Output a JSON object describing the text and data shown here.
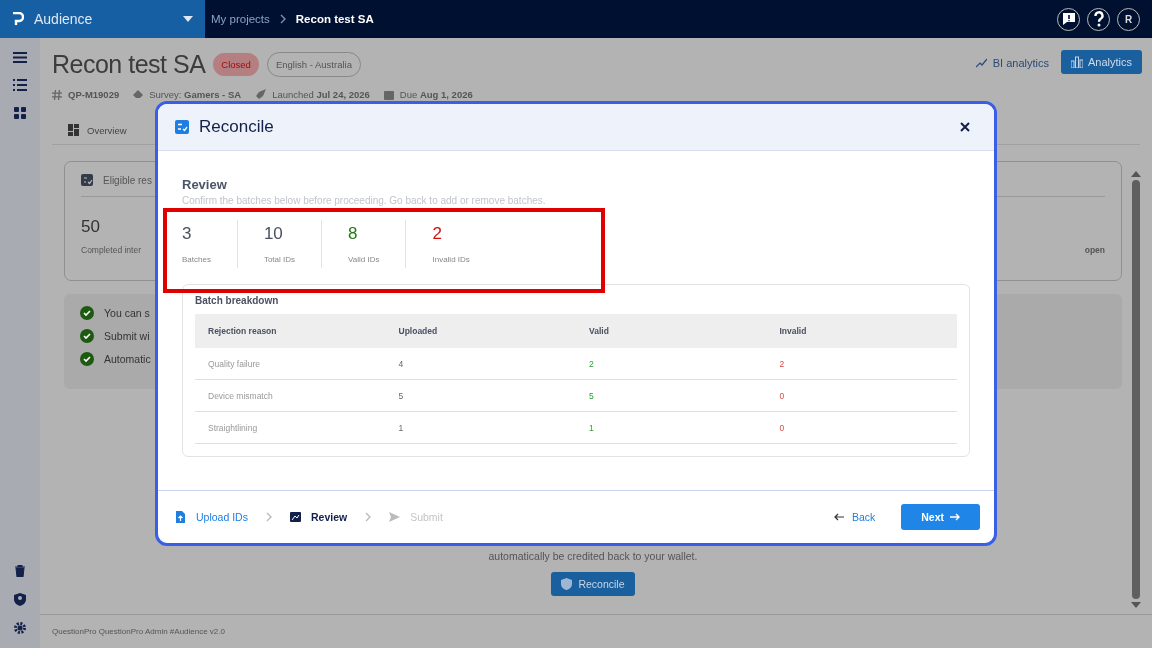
{
  "topbar": {
    "product": "Audience",
    "breadcrumb": [
      {
        "label": "My projects",
        "current": false
      },
      {
        "label": "Recon test SA",
        "current": true
      }
    ],
    "avatar": "R"
  },
  "project": {
    "title": "Recon test SA",
    "status": "Closed",
    "language": "English - Australia",
    "id": "QP-M19029",
    "survey_label": "Survey:",
    "survey": "Gamers - SA",
    "launched_label": "Launched",
    "launched": "Jul 24, 2026",
    "due_label": "Due",
    "due": "Aug 1, 2026"
  },
  "header_actions": [
    {
      "label": "BI analytics",
      "kind": "link"
    },
    {
      "label": "Analytics",
      "kind": "primary"
    }
  ],
  "tabs": [
    {
      "label": "Overview",
      "selected": false
    }
  ],
  "background": {
    "card_title": "Eligible res",
    "metric_value": "50",
    "metric_label": "Completed inter",
    "right_label": "open",
    "checklist": [
      "You can s",
      "Submit wi",
      "Automatic"
    ],
    "note": "automatically be credited back to your wallet.",
    "button": "Reconcile",
    "footer": "QuestionPro QuestionPro Admin  #Audience v2.0"
  },
  "modal": {
    "title": "Reconcile",
    "section_title": "Review",
    "section_text": "Confirm the batches below before proceeding. Go back to add or remove batches.",
    "stats": [
      {
        "value": "3",
        "label": "Batches",
        "color": "#4a5060"
      },
      {
        "value": "10",
        "label": "Total IDs",
        "color": "#4a5060"
      },
      {
        "value": "8",
        "label": "Valid IDs",
        "color": "#1f7a10"
      },
      {
        "value": "2",
        "label": "Invalid IDs",
        "color": "#d20f0f"
      }
    ],
    "breakdown_title": "Batch breakdown",
    "columns": [
      "Rejection reason",
      "Uploaded",
      "Valid",
      "Invalid"
    ],
    "rows": [
      [
        "Quality failure",
        "4",
        "2",
        "2"
      ],
      [
        "Device mismatch",
        "5",
        "5",
        "0"
      ],
      [
        "Straightlining",
        "1",
        "1",
        "0"
      ]
    ],
    "steps": [
      {
        "label": "Upload IDs",
        "kind": "upload",
        "selected": false,
        "disabled": false
      },
      {
        "label": "Review",
        "kind": "review",
        "selected": true,
        "disabled": false
      },
      {
        "label": "Submit",
        "kind": "submit",
        "selected": false,
        "disabled": true
      }
    ],
    "back": "Back",
    "next": "Next"
  }
}
